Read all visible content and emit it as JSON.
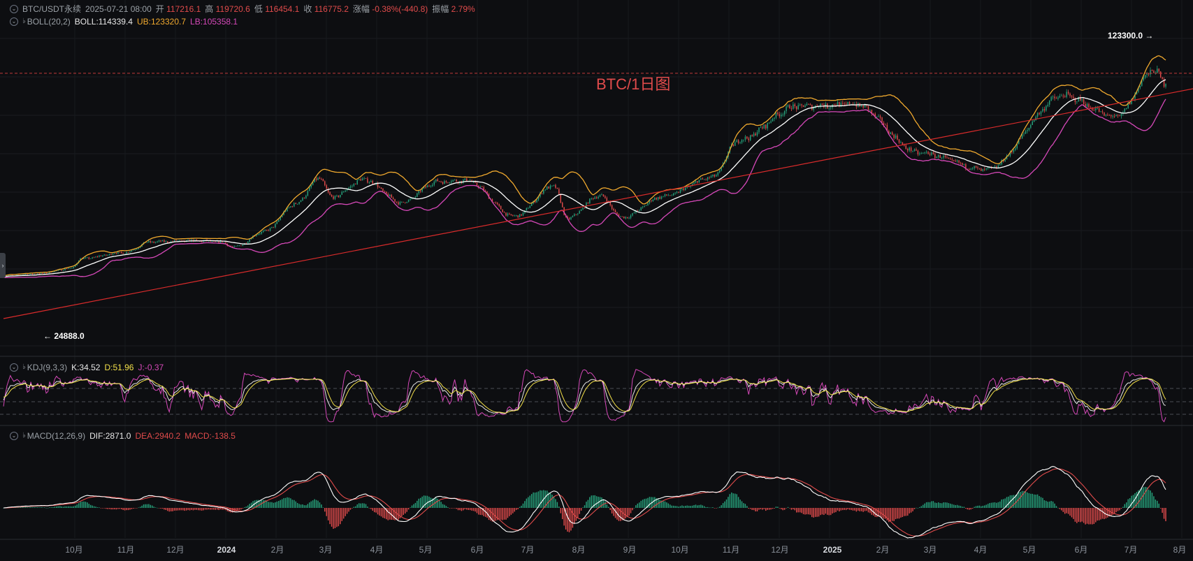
{
  "header": {
    "symbol": "BTC/USDT永续",
    "datetime": "2025-07-21 08:00",
    "open_label": "开",
    "open": "117216.1",
    "high_label": "高",
    "high": "119720.6",
    "low_label": "低",
    "low": "116454.1",
    "close_label": "收",
    "close": "116775.2",
    "change_label": "涨幅",
    "change": "-0.38%(-440.8)",
    "amplitude_label": "振幅",
    "amplitude": "2.79%"
  },
  "boll": {
    "name": "BOLL(20,2)",
    "mid": "BOLL:114339.4",
    "ub": "UB:123320.7",
    "lb": "LB:105358.1"
  },
  "kdj": {
    "name": "KDJ(9,3,3)",
    "k": "K:34.52",
    "d": "D:51.96",
    "j": "J:-0.37"
  },
  "macd": {
    "name": "MACD(12,26,9)",
    "dif": "DIF:2871.0",
    "dea": "DEA:2940.2",
    "hist": "MACD:-138.5"
  },
  "annotation": "BTC/1日图",
  "high_marker": "123300.0",
  "low_marker": "24888.0",
  "colors": {
    "up": "#26a17b",
    "down": "#e04b4b",
    "mid": "#ffffff",
    "ub": "#f0a92e",
    "lb": "#d548b8",
    "trend": "#d92b2b",
    "k_line": "#e8e8e8",
    "d_line": "#f3e04a",
    "j_line": "#d548b8"
  },
  "icons": {
    "collapse": "chevron-circle-icon",
    "alert": "bell-icon",
    "expand": "chevron-right-icon"
  },
  "chart_data": {
    "type": "candlestick",
    "interval": "1D",
    "x_ticks": [
      "10月",
      "11月",
      "12月",
      "2024",
      "2月",
      "3月",
      "4月",
      "5月",
      "6月",
      "7月",
      "8月",
      "9月",
      "10月",
      "11月",
      "12月",
      "2025",
      "2月",
      "3月",
      "4月",
      "5月",
      "6月",
      "7月",
      "8月"
    ],
    "price_keypoints": [
      [
        "2023-09-10",
        25800
      ],
      [
        "2023-10-01",
        27000
      ],
      [
        "2023-10-20",
        29500
      ],
      [
        "2023-10-25",
        34000
      ],
      [
        "2023-11-20",
        37000
      ],
      [
        "2023-12-05",
        42000
      ],
      [
        "2023-12-31",
        42500
      ],
      [
        "2024-01-15",
        42000
      ],
      [
        "2024-01-23",
        39500
      ],
      [
        "2024-02-10",
        47000
      ],
      [
        "2024-02-28",
        60000
      ],
      [
        "2024-03-13",
        72000
      ],
      [
        "2024-03-20",
        63000
      ],
      [
        "2024-04-08",
        71500
      ],
      [
        "2024-04-30",
        60500
      ],
      [
        "2024-05-21",
        70500
      ],
      [
        "2024-06-07",
        71000
      ],
      [
        "2024-07-05",
        54000
      ],
      [
        "2024-07-28",
        68500
      ],
      [
        "2024-08-05",
        53000
      ],
      [
        "2024-08-24",
        64000
      ],
      [
        "2024-09-06",
        53500
      ],
      [
        "2024-09-30",
        63500
      ],
      [
        "2024-10-29",
        72500
      ],
      [
        "2024-11-13",
        90000
      ],
      [
        "2024-12-17",
        106000
      ],
      [
        "2025-01-20",
        107000
      ],
      [
        "2025-02-27",
        84000
      ],
      [
        "2025-04-07",
        76000
      ],
      [
        "2025-05-22",
        111000
      ],
      [
        "2025-06-22",
        101000
      ],
      [
        "2025-07-14",
        123000
      ],
      [
        "2025-07-21",
        116775
      ]
    ],
    "high_marker": {
      "value": 123300.0
    },
    "low_marker": {
      "value": 24888.0
    },
    "indicators": [
      "BOLL(20,2)",
      "KDJ(9,3,3)",
      "MACD(12,26,9)"
    ]
  }
}
